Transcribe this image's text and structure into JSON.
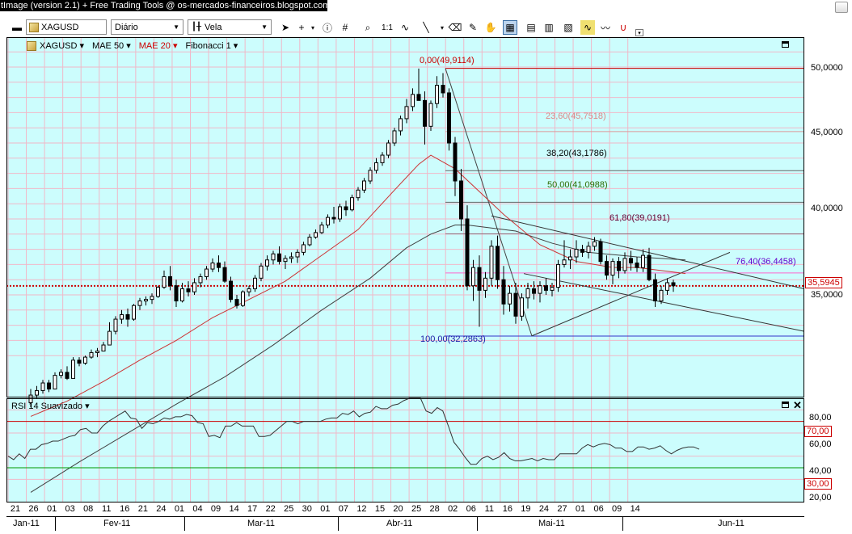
{
  "window": {
    "title": "tImage (version 2.1) + Free Trading Tools @ os-mercados-financeiros.blogspot.com"
  },
  "toolbar": {
    "symbol": "XAGUSD",
    "timeframe": "Diário",
    "chart_style": "Vela"
  },
  "price_panel": {
    "legend": [
      {
        "label": "XAGUSD",
        "color": "#000000"
      },
      {
        "label": "MAE 50",
        "color": "#000000"
      },
      {
        "label": "MAE 20",
        "color": "#cc0000"
      },
      {
        "label": "Fibonacci 1",
        "color": "#000000"
      }
    ],
    "current_price": "35,5945",
    "y_ticks": [
      "50,0000",
      "45,0000",
      "40,0000",
      "35,0000"
    ],
    "fib_levels": [
      {
        "label": "0,00(49,9114)",
        "price": 49.9114,
        "color": "#cc0000",
        "text_color": "#cc0000"
      },
      {
        "label": "23,60(45,7518)",
        "price": 45.7518,
        "color": "#dd9999",
        "text_color": "#dd8888"
      },
      {
        "label": "38,20(43,1786)",
        "price": 43.1786,
        "color": "#666666",
        "text_color": "#000000"
      },
      {
        "label": "50,00(41,0988)",
        "price": 41.0988,
        "color": "#666666",
        "text_color": "#2e6b00"
      },
      {
        "label": "61,80(39,0191)",
        "price": 39.0191,
        "color": "#996677",
        "text_color": "#660033"
      },
      {
        "label": "76,40(36,4458)",
        "price": 36.4458,
        "color": "#ff66cc",
        "text_color": "#6600cc"
      },
      {
        "label": "100,00(32,2863)",
        "price": 32.2863,
        "color": "#3333cc",
        "text_color": "#1a1aa6"
      }
    ]
  },
  "rsi_panel": {
    "title": "RSI 14 Suavizado",
    "y_ticks": [
      "80,00",
      "60,00",
      "40,00",
      "20,00"
    ],
    "overbought": "70,00",
    "oversold": "30,00",
    "values": [
      40,
      37,
      42,
      38,
      46,
      46,
      50,
      51,
      53,
      53,
      55,
      57,
      58,
      63,
      64,
      60,
      60,
      66,
      70,
      73,
      76,
      79,
      73,
      72,
      64,
      69,
      68,
      70,
      73,
      72,
      74,
      74,
      76,
      75,
      69,
      68,
      57,
      58,
      56,
      66,
      66,
      69,
      66,
      66,
      66,
      57,
      57,
      58,
      62,
      66,
      70,
      70,
      68,
      70,
      70,
      70,
      70,
      72,
      73,
      73,
      77,
      76,
      79,
      74,
      77,
      78,
      83,
      81,
      81,
      84,
      85,
      88,
      90,
      90,
      90,
      79,
      77,
      82,
      79,
      66,
      52,
      46,
      39,
      33,
      33,
      38,
      40,
      37,
      39,
      43,
      38,
      36,
      36,
      37,
      38,
      36,
      38,
      37,
      37,
      42,
      42,
      42,
      42,
      47,
      50,
      48,
      50,
      51,
      50,
      47,
      47,
      44,
      44,
      48,
      48,
      46,
      47,
      49,
      45,
      42,
      45,
      47,
      48,
      48,
      46
    ]
  },
  "date_axis": {
    "days": [
      "21",
      "26",
      "01",
      "03",
      "08",
      "11",
      "16",
      "21",
      "24",
      "01",
      "04",
      "09",
      "14",
      "17",
      "22",
      "25",
      "30",
      "01",
      "07",
      "12",
      "15",
      "20",
      "25",
      "28",
      "02",
      "06",
      "11",
      "16",
      "19",
      "24",
      "27",
      "01",
      "06",
      "09",
      "14"
    ],
    "months": [
      "Jan-11",
      "Fev-11",
      "Mar-11",
      "Abr-11",
      "Mai-11",
      "Jun-11"
    ]
  },
  "chart_data": {
    "type": "candlestick",
    "symbol": "XAGUSD",
    "interval": "daily",
    "ylim": [
      30.5,
      51.0
    ],
    "candles": [
      [
        27.9,
        28.8,
        27.6,
        28.4
      ],
      [
        28.4,
        29.0,
        28.2,
        28.7
      ],
      [
        28.7,
        29.4,
        28.5,
        29.2
      ],
      [
        29.2,
        29.4,
        28.6,
        28.8
      ],
      [
        28.8,
        29.9,
        28.8,
        29.7
      ],
      [
        29.7,
        30.1,
        29.5,
        29.9
      ],
      [
        29.9,
        30.3,
        29.4,
        29.5
      ],
      [
        29.5,
        30.9,
        29.5,
        30.7
      ],
      [
        30.7,
        30.9,
        30.3,
        30.5
      ],
      [
        30.5,
        31.0,
        30.4,
        30.9
      ],
      [
        30.9,
        31.4,
        30.8,
        31.2
      ],
      [
        31.2,
        31.5,
        30.9,
        31.3
      ],
      [
        31.3,
        31.9,
        31.3,
        31.7
      ],
      [
        31.7,
        33.2,
        31.7,
        32.6
      ],
      [
        32.6,
        33.6,
        32.4,
        33.4
      ],
      [
        33.4,
        34.0,
        33.1,
        33.7
      ],
      [
        33.7,
        34.1,
        32.9,
        33.4
      ],
      [
        33.4,
        34.4,
        33.3,
        34.3
      ],
      [
        34.3,
        34.8,
        34.0,
        34.6
      ],
      [
        34.6,
        34.9,
        34.3,
        34.7
      ],
      [
        34.7,
        35.1,
        34.4,
        34.9
      ],
      [
        34.9,
        35.6,
        34.8,
        35.5
      ],
      [
        35.5,
        36.6,
        35.4,
        36.2
      ],
      [
        36.2,
        36.9,
        35.3,
        35.6
      ],
      [
        35.6,
        36.0,
        34.2,
        34.6
      ],
      [
        34.6,
        35.8,
        34.5,
        35.4
      ],
      [
        35.4,
        35.9,
        34.9,
        35.2
      ],
      [
        35.2,
        36.1,
        35.0,
        35.8
      ],
      [
        35.8,
        36.4,
        35.5,
        36.2
      ],
      [
        36.2,
        36.9,
        36.0,
        36.7
      ],
      [
        36.7,
        37.4,
        36.5,
        37.1
      ],
      [
        37.1,
        37.6,
        36.5,
        36.8
      ],
      [
        36.8,
        37.2,
        35.8,
        35.9
      ],
      [
        35.9,
        36.2,
        34.5,
        34.7
      ],
      [
        34.7,
        35.0,
        34.1,
        34.3
      ],
      [
        34.3,
        35.3,
        34.2,
        35.2
      ],
      [
        35.2,
        35.6,
        34.9,
        35.4
      ],
      [
        35.4,
        36.3,
        35.2,
        36.1
      ],
      [
        36.1,
        37.1,
        35.9,
        36.9
      ],
      [
        36.9,
        37.6,
        36.6,
        37.3
      ],
      [
        37.3,
        37.9,
        37.0,
        37.7
      ],
      [
        37.7,
        38.2,
        37.0,
        37.2
      ],
      [
        37.2,
        37.6,
        36.7,
        37.4
      ],
      [
        37.4,
        37.8,
        37.1,
        37.5
      ],
      [
        37.5,
        38.0,
        37.1,
        37.8
      ],
      [
        37.8,
        38.5,
        37.6,
        38.3
      ],
      [
        38.3,
        39.0,
        38.2,
        38.8
      ],
      [
        38.8,
        39.3,
        38.7,
        39.1
      ],
      [
        39.1,
        39.8,
        39.0,
        39.6
      ],
      [
        39.6,
        40.3,
        39.4,
        40.1
      ],
      [
        40.1,
        40.8,
        39.7,
        40.0
      ],
      [
        40.0,
        41.0,
        39.8,
        40.8
      ],
      [
        40.8,
        41.2,
        40.2,
        40.6
      ],
      [
        40.6,
        41.6,
        40.5,
        41.4
      ],
      [
        41.4,
        42.1,
        41.2,
        41.9
      ],
      [
        41.9,
        42.7,
        41.7,
        42.5
      ],
      [
        42.5,
        43.4,
        42.3,
        43.2
      ],
      [
        43.2,
        44.0,
        43.0,
        43.7
      ],
      [
        43.7,
        44.4,
        43.5,
        44.2
      ],
      [
        44.2,
        45.2,
        44.0,
        45.0
      ],
      [
        45.0,
        46.0,
        44.8,
        45.8
      ],
      [
        45.8,
        46.8,
        45.5,
        46.6
      ],
      [
        46.6,
        47.9,
        46.3,
        47.4
      ],
      [
        47.4,
        48.6,
        47.1,
        48.2
      ],
      [
        48.2,
        49.9,
        47.9,
        47.8
      ],
      [
        47.8,
        48.4,
        44.9,
        46.1
      ],
      [
        46.1,
        47.8,
        45.8,
        47.6
      ],
      [
        47.6,
        49.4,
        47.3,
        48.8
      ],
      [
        48.8,
        49.6,
        48.0,
        48.3
      ],
      [
        48.3,
        48.6,
        44.5,
        45.0
      ],
      [
        45.0,
        45.4,
        41.5,
        42.5
      ],
      [
        42.5,
        43.3,
        39.2,
        40.0
      ],
      [
        40.0,
        40.9,
        35.3,
        35.6
      ],
      [
        35.6,
        37.3,
        34.6,
        36.8
      ],
      [
        36.8,
        37.6,
        32.9,
        35.3
      ],
      [
        35.3,
        36.5,
        34.8,
        36.1
      ],
      [
        36.1,
        38.6,
        35.6,
        38.2
      ],
      [
        38.2,
        38.9,
        35.4,
        36.0
      ],
      [
        36.0,
        36.9,
        33.7,
        34.4
      ],
      [
        34.4,
        35.6,
        33.9,
        35.1
      ],
      [
        35.1,
        35.8,
        33.1,
        33.6
      ],
      [
        33.6,
        35.1,
        33.3,
        34.8
      ],
      [
        34.8,
        35.8,
        34.1,
        35.4
      ],
      [
        35.4,
        35.9,
        34.7,
        35.1
      ],
      [
        35.1,
        35.9,
        34.5,
        35.6
      ],
      [
        35.6,
        36.1,
        35.0,
        35.3
      ],
      [
        35.3,
        35.8,
        34.9,
        35.5
      ],
      [
        35.5,
        37.3,
        35.2,
        37.0
      ],
      [
        37.0,
        38.6,
        36.8,
        37.3
      ],
      [
        37.3,
        38.0,
        36.7,
        37.5
      ],
      [
        37.5,
        38.6,
        37.1,
        38.0
      ],
      [
        38.0,
        38.3,
        37.5,
        37.8
      ],
      [
        37.8,
        38.5,
        37.4,
        38.2
      ],
      [
        38.2,
        38.8,
        37.9,
        38.5
      ],
      [
        38.5,
        38.7,
        37.0,
        37.2
      ],
      [
        37.2,
        37.6,
        36.0,
        36.3
      ],
      [
        36.3,
        37.4,
        35.7,
        37.2
      ],
      [
        37.2,
        37.5,
        36.1,
        36.6
      ],
      [
        36.6,
        37.8,
        36.4,
        37.4
      ],
      [
        37.4,
        37.9,
        36.6,
        37.1
      ],
      [
        37.1,
        37.5,
        36.5,
        36.8
      ],
      [
        36.8,
        38.0,
        36.5,
        37.6
      ],
      [
        37.6,
        38.1,
        35.9,
        36.0
      ],
      [
        36.0,
        36.4,
        34.2,
        34.6
      ],
      [
        34.6,
        35.6,
        34.4,
        35.3
      ],
      [
        35.3,
        36.1,
        35.0,
        35.8
      ],
      [
        35.8,
        36.0,
        35.2,
        35.6
      ]
    ],
    "mae20": [
      [
        0,
        27.0
      ],
      [
        6,
        28.0
      ],
      [
        12,
        29.3
      ],
      [
        18,
        30.7
      ],
      [
        24,
        32.0
      ],
      [
        30,
        33.5
      ],
      [
        36,
        34.7
      ],
      [
        42,
        35.9
      ],
      [
        48,
        37.6
      ],
      [
        54,
        39.3
      ],
      [
        60,
        41.9
      ],
      [
        64,
        43.6
      ],
      [
        66,
        44.2
      ],
      [
        70,
        43.3
      ],
      [
        74,
        41.8
      ],
      [
        78,
        40.3
      ],
      [
        84,
        38.3
      ],
      [
        90,
        37.2
      ],
      [
        96,
        36.8
      ],
      [
        100,
        36.8
      ],
      [
        104,
        36.6
      ],
      [
        108,
        36.4
      ]
    ],
    "mae50": [
      [
        0,
        22.0
      ],
      [
        8,
        24.0
      ],
      [
        16,
        25.9
      ],
      [
        24,
        27.8
      ],
      [
        32,
        29.6
      ],
      [
        40,
        31.7
      ],
      [
        48,
        34.0
      ],
      [
        56,
        36.1
      ],
      [
        62,
        38.1
      ],
      [
        66,
        39.0
      ],
      [
        70,
        39.6
      ],
      [
        72,
        39.6
      ],
      [
        76,
        39.4
      ],
      [
        80,
        39.2
      ],
      [
        86,
        38.4
      ],
      [
        92,
        37.8
      ],
      [
        100,
        37.5
      ],
      [
        104,
        37.4
      ],
      [
        108,
        37.3
      ]
    ]
  }
}
